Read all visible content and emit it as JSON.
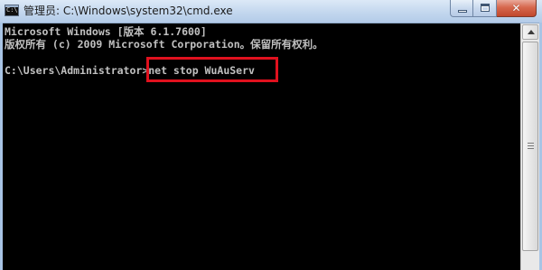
{
  "window": {
    "title": "管理员: C:\\Windows\\system32\\cmd.exe",
    "icon": "cmd-icon",
    "caption_buttons": [
      "minimize-icon",
      "maximize-icon",
      "close-icon"
    ],
    "close_glyph": "✕"
  },
  "console": {
    "lines": [
      "Microsoft Windows [版本 6.1.7600]",
      "版权所有 (c) 2009 Microsoft Corporation。保留所有权利。",
      "C:\\Users\\Administrator>net stop WuAuServ"
    ],
    "prompt": "C:\\Users\\Administrator>",
    "command": "net stop WuAuServ",
    "text_color": "#c0c0c0",
    "background_color": "#000000"
  },
  "annotation": {
    "highlight_color": "#e0111e",
    "highlight_target": "command"
  }
}
